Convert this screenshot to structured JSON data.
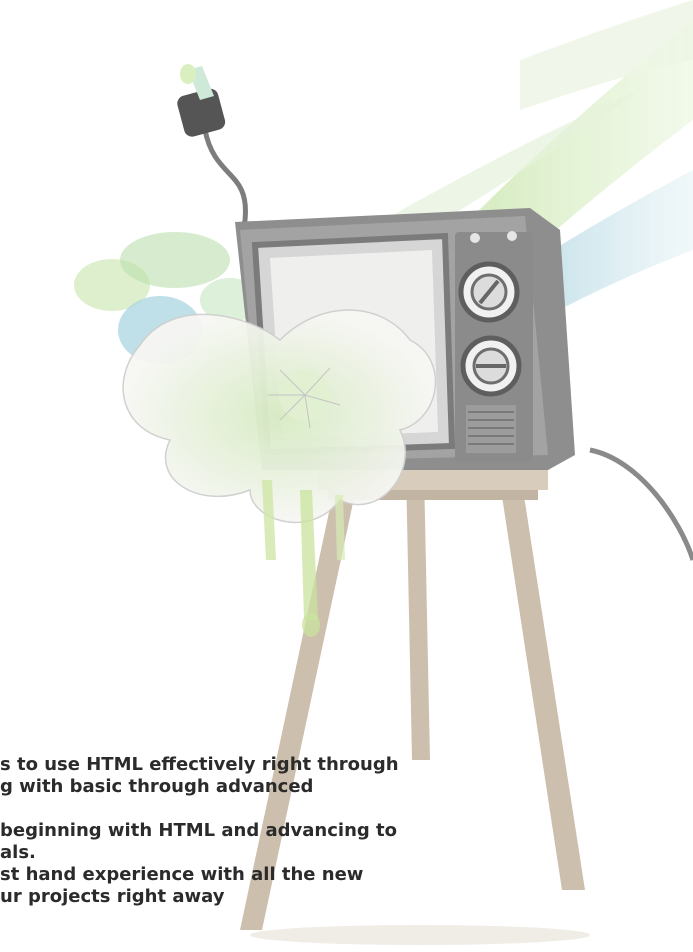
{
  "promo": {
    "lines": [
      "s to use HTML effectively right through",
      "g with basic through advanced",
      "beginning with HTML and advancing to",
      "als.",
      "st hand experience with all the new",
      "ur projects right away"
    ]
  },
  "illustration": {
    "subject": "retro-tv-on-easel-with-flower",
    "colors": {
      "tv_body": "#9a9a9a",
      "tv_screen_frame": "#cfcfcf",
      "easel_wood": "#c9bba8",
      "swoosh_green": "#b9dca0",
      "swoosh_blue": "#9fcbd6",
      "flower": "#f4f4f0",
      "text": "#2b2b2b"
    }
  }
}
